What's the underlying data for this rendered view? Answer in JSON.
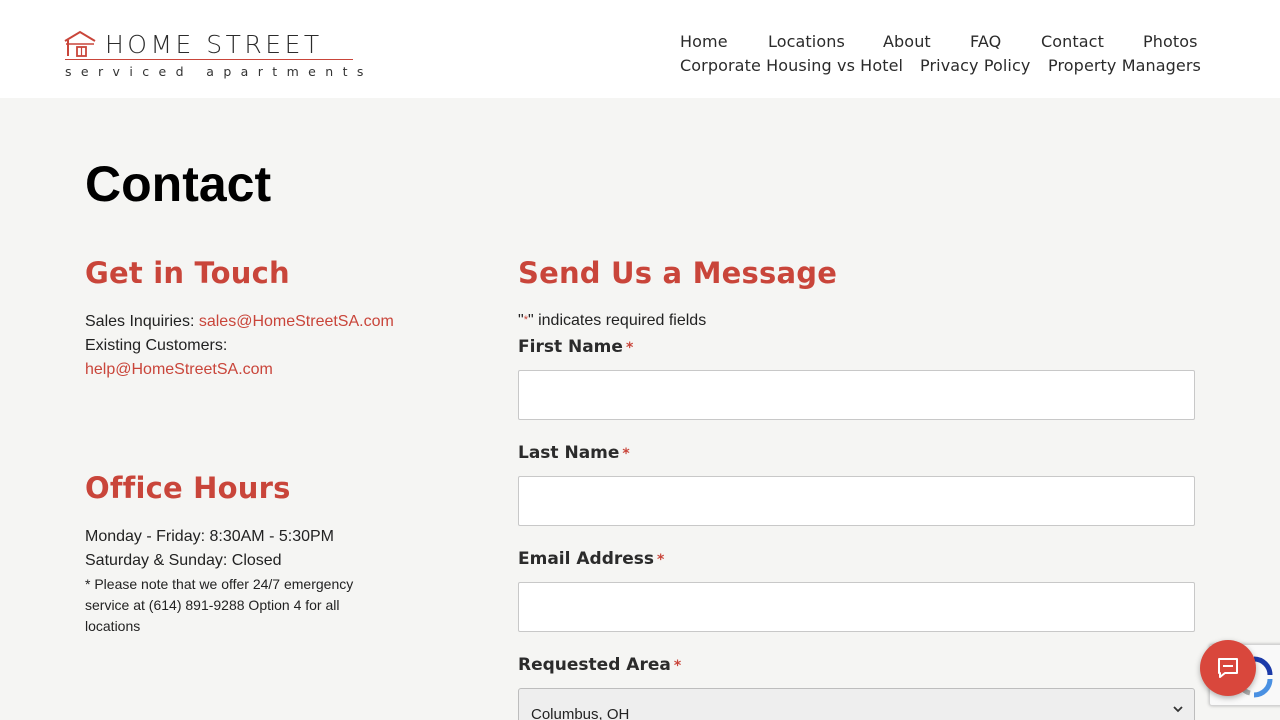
{
  "brand": {
    "title": "HOME STREET",
    "subtitle": "serviced apartments",
    "accent_color": "#c9453a",
    "logo_icon": "house-logo-icon"
  },
  "nav": {
    "home": "Home",
    "locations": "Locations",
    "about": "About",
    "faq": "FAQ",
    "contact": "Contact",
    "photos": "Photos",
    "corporate_housing": "Corporate Housing vs Hotel",
    "privacy_policy": "Privacy Policy",
    "property_managers": "Property Managers"
  },
  "page": {
    "title": "Contact"
  },
  "get_in_touch": {
    "heading": "Get in Touch",
    "sales_label": "Sales Inquiries:",
    "sales_email": "sales@HomeStreetSA.com",
    "existing_label": "Existing Customers:",
    "help_email": "help@HomeStreetSA.com"
  },
  "office_hours": {
    "heading": "Office Hours",
    "weekdays": "Monday - Friday: 8:30AM - 5:30PM",
    "weekend": "Saturday & Sunday: Closed",
    "note": "* Please note that we offer 24/7 emergency service at (614) 891-9288 Option 4 for all locations"
  },
  "form": {
    "heading": "Send Us a Message",
    "required_note_open": "\"",
    "required_note_star": "*",
    "required_note_close": "\" indicates required fields",
    "required_star": "*",
    "first_name_label": "First Name",
    "last_name_label": "Last Name",
    "email_label": "Email Address",
    "area_label": "Requested Area",
    "area_selected": "Columbus, OH",
    "first_name_value": "",
    "last_name_value": "",
    "email_value": ""
  },
  "widgets": {
    "chat_icon": "chat-bubble-icon",
    "recaptcha_icon": "recaptcha-icon"
  }
}
